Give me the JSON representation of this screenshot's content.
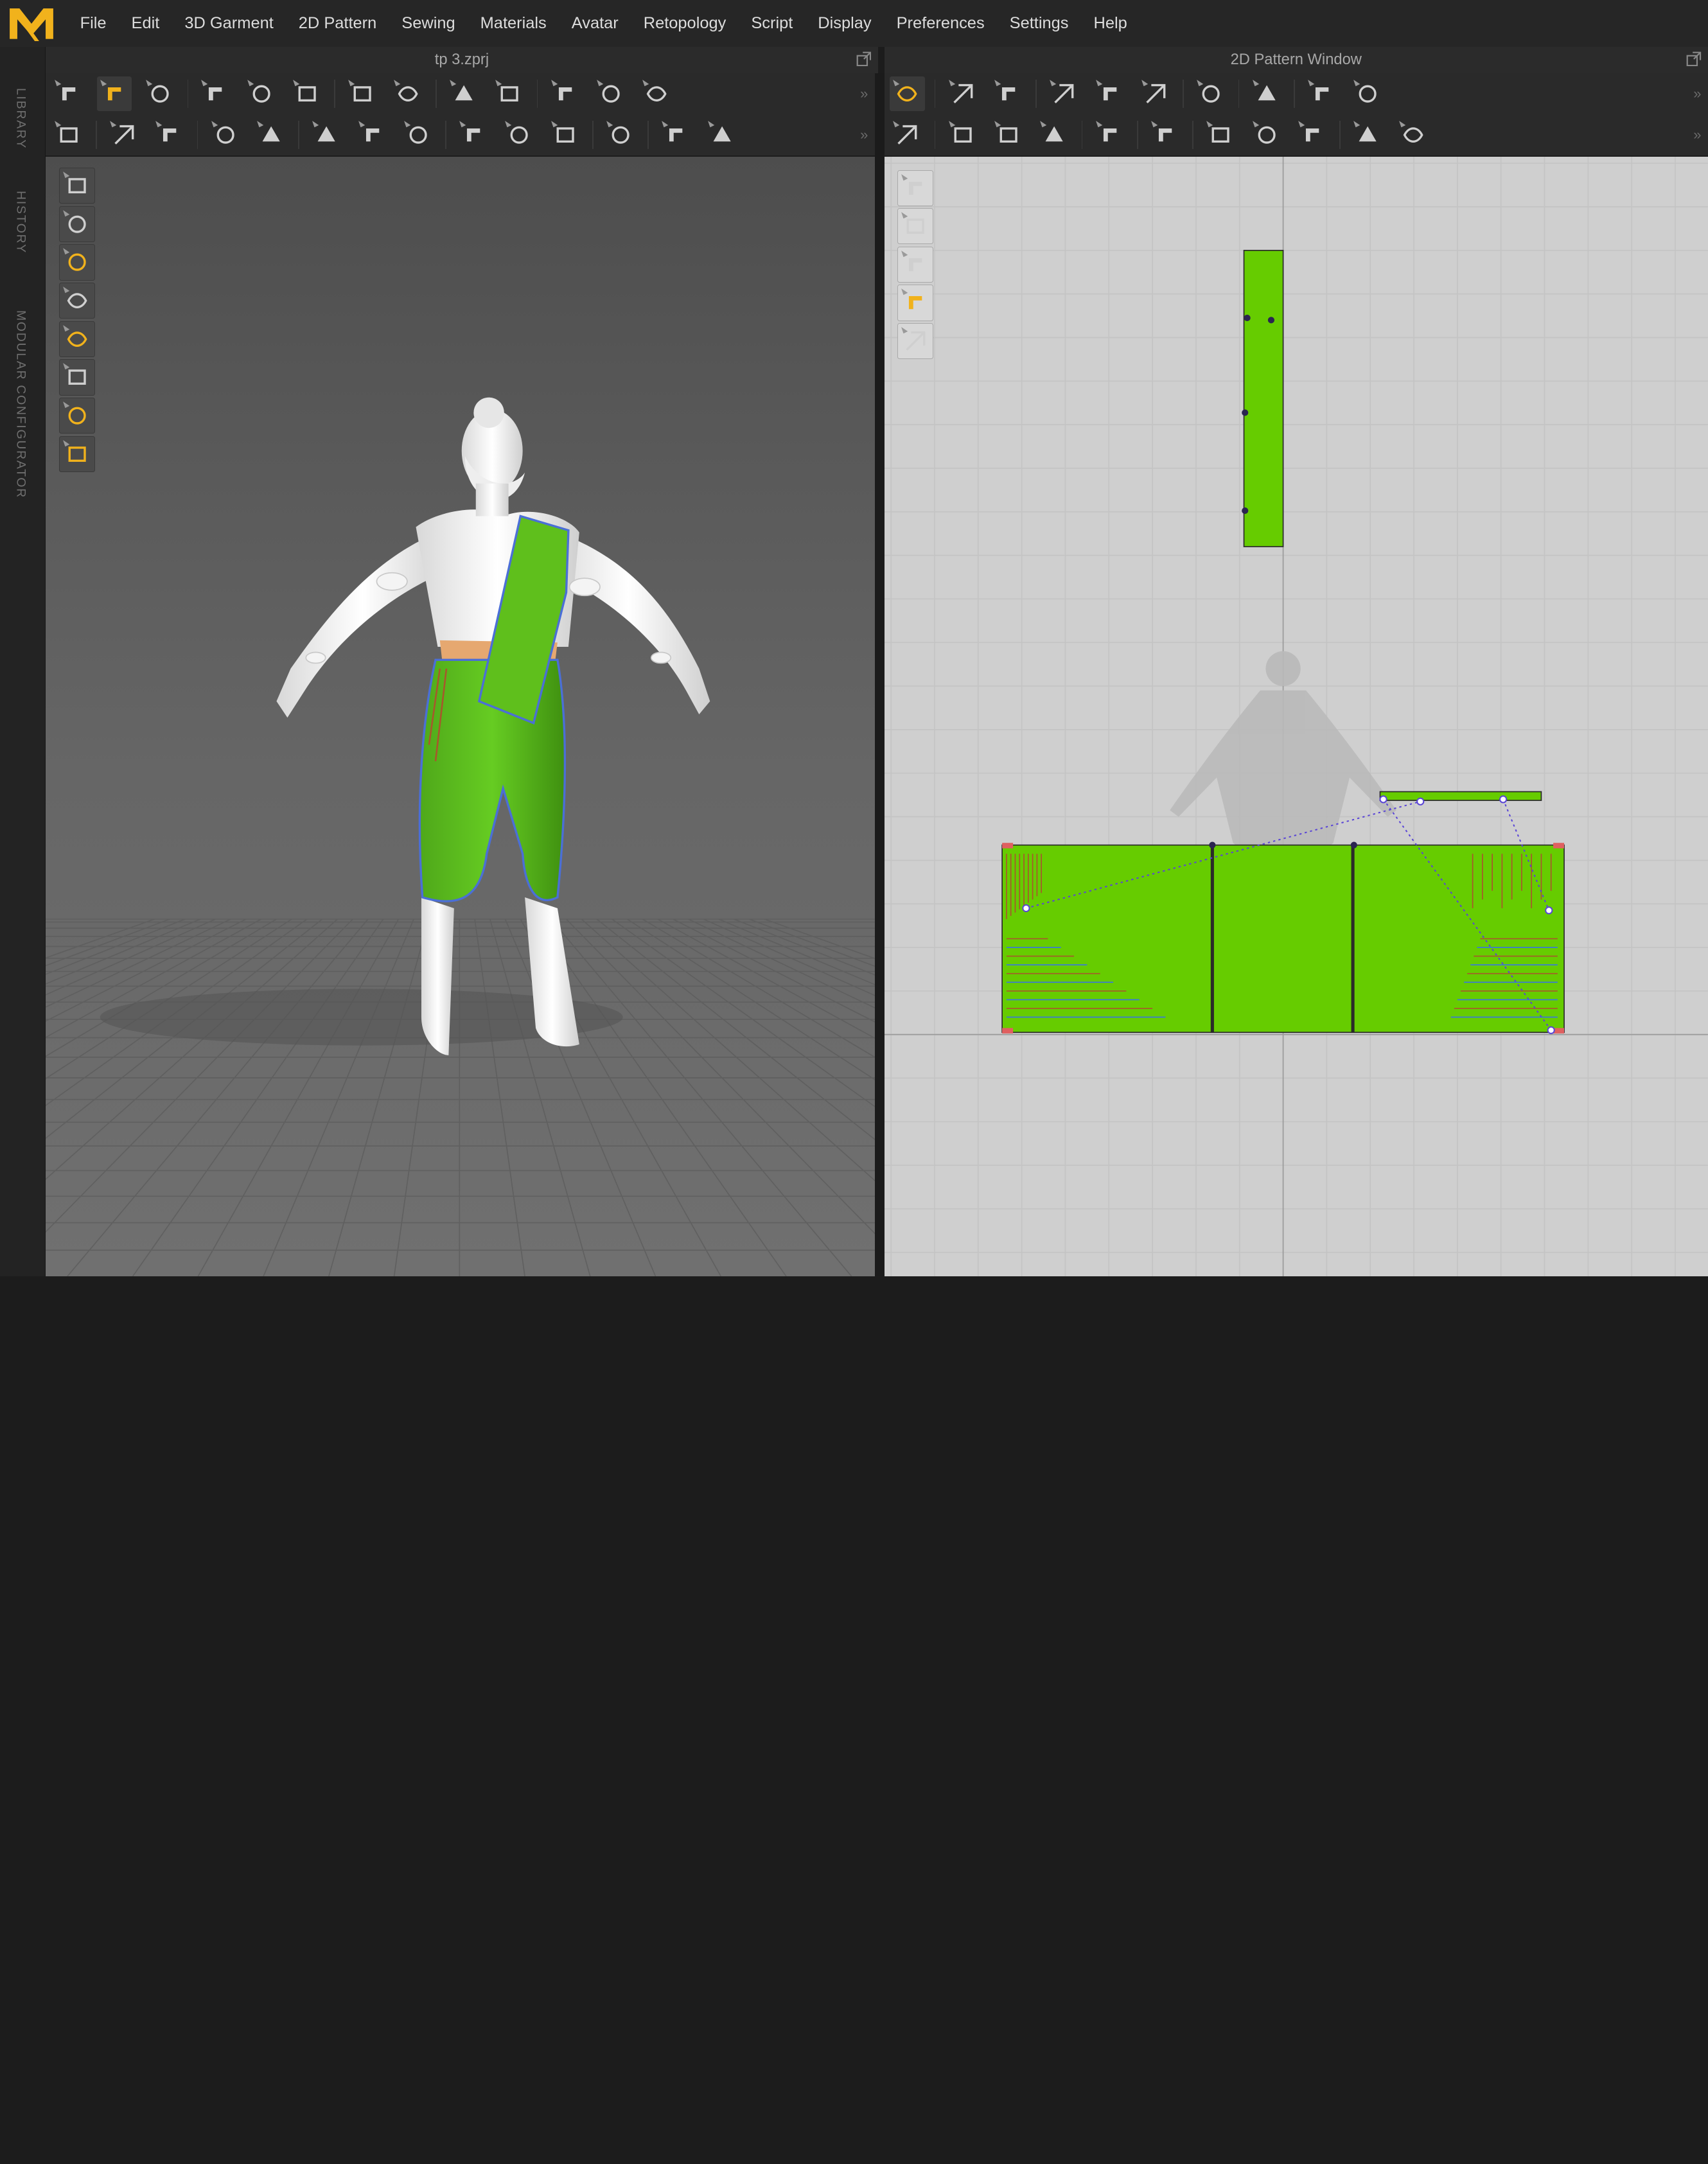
{
  "app": {
    "logo_text": "M",
    "menu": [
      "File",
      "Edit",
      "3D Garment",
      "2D Pattern",
      "Sewing",
      "Materials",
      "Avatar",
      "Retopology",
      "Script",
      "Display",
      "Preferences",
      "Settings",
      "Help"
    ]
  },
  "side_tabs": [
    "LIBRARY",
    "HISTORY",
    "MODULAR CONFIGURATOR"
  ],
  "windows": {
    "left_title": "tp 3.zprj",
    "right_title": "2D Pattern Window"
  },
  "toolbars": {
    "left_row1": [
      "arrow-down-icon",
      "select-move-icon",
      "transform-box-icon",
      "sep",
      "fold-arrange-icon",
      "fold-point-icon",
      "fold-rotate-icon",
      "sep",
      "tack-icon",
      "tack-cloud-icon",
      "sep",
      "pin-line-icon",
      "pin-bezier-icon",
      "sep",
      "arrangement-icon",
      "shirt-front-icon",
      "shirt-split-icon"
    ],
    "left_row2": [
      "walk-icon",
      "sep",
      "gizmo-drag-icon",
      "gizmo-rotate-icon",
      "sep",
      "sew-draw-icon",
      "sew-cut-icon",
      "sep",
      "avatar-measure-icon",
      "avatar-grid-icon",
      "avatar-check-icon",
      "sep",
      "button-icon",
      "buttonhole-icon",
      "lock-icon",
      "sep",
      "zipper-icon",
      "sep",
      "flat-iron-icon",
      "board-icon"
    ],
    "right_row1": [
      "edit-pattern-icon",
      "sep",
      "edit-point-icon",
      "edit-curve-icon",
      "sep",
      "rectangle-icon",
      "polygon-icon",
      "dart-icon",
      "sep",
      "segment-split-icon",
      "sep",
      "avatar-select-icon",
      "sep",
      "grid-icon",
      "grid-3d-icon"
    ],
    "right_row2": [
      "seam-allowance-icon",
      "sep",
      "trace-icon",
      "trace-curve-icon",
      "trace-cut-icon",
      "sep",
      "iron-icon",
      "sep",
      "shirt-small-icon",
      "sep",
      "pin-sew-icon",
      "mannequin-icon",
      "fabric-grid-icon",
      "sep",
      "line-icon",
      "dash-line-icon"
    ],
    "more_glyph": "»"
  },
  "viewport_tools": [
    "box-icon",
    "garment-icon",
    "particle-icon",
    "avatar-icon",
    "fabric-icon",
    "texture-icon",
    "head-icon",
    "globe-icon"
  ],
  "pattern_tools": [
    "brush-icon",
    "shirt-outline-icon",
    "info-icon",
    "fabric-swatch-icon",
    "shirt-locked-icon"
  ],
  "colors": {
    "garment_green": "#66cc00",
    "seam_blue": "#4b6fd6",
    "accent_yellow": "#f1b21c",
    "sewing_line": "#5a45d6"
  }
}
